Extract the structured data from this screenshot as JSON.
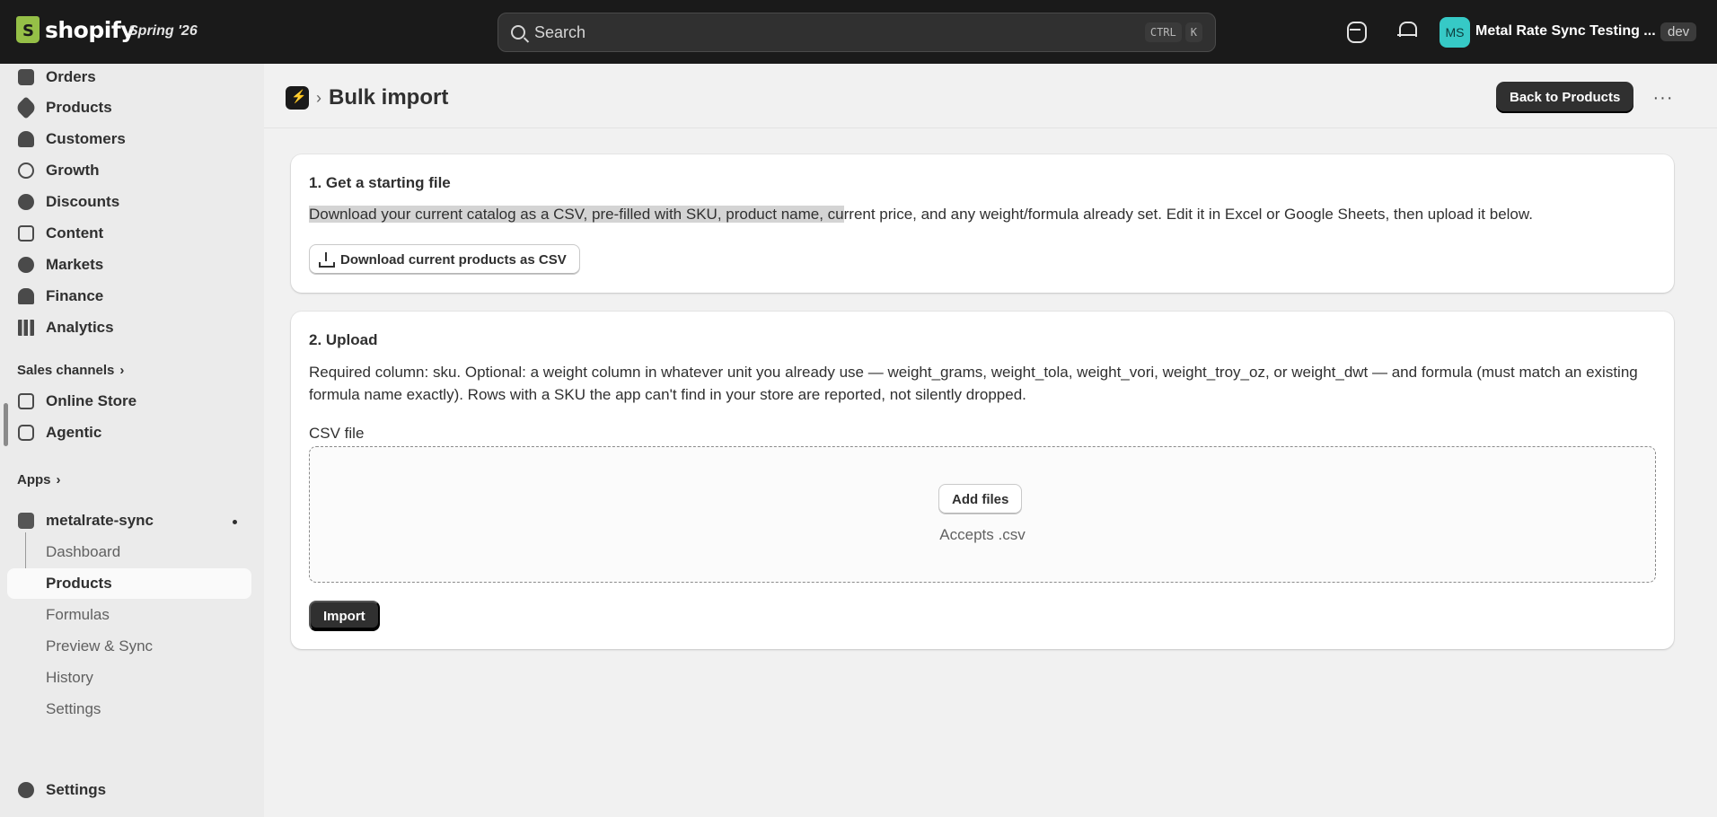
{
  "topbar": {
    "logo_text": "shopify",
    "edition": "Spring '26",
    "search_placeholder": "Search",
    "shortcut_keys": [
      "CTRL",
      "K"
    ],
    "avatar_initials": "MS",
    "store_name": "Metal Rate Sync Testing ...",
    "env_badge": "dev"
  },
  "sidebar": {
    "items": [
      {
        "label": "Orders",
        "icon": "inbox-icon"
      },
      {
        "label": "Products",
        "icon": "tag-icon"
      },
      {
        "label": "Customers",
        "icon": "person-icon"
      },
      {
        "label": "Growth",
        "icon": "gauge-icon"
      },
      {
        "label": "Discounts",
        "icon": "discount-icon"
      },
      {
        "label": "Content",
        "icon": "content-icon"
      },
      {
        "label": "Markets",
        "icon": "globe-icon"
      },
      {
        "label": "Finance",
        "icon": "bank-icon"
      },
      {
        "label": "Analytics",
        "icon": "bar-chart-icon"
      }
    ],
    "sales_channels_heading": "Sales channels",
    "channels": [
      {
        "label": "Online Store",
        "icon": "store-icon"
      },
      {
        "label": "Agentic",
        "icon": "robot-icon"
      }
    ],
    "apps_heading": "Apps",
    "app_name": "metalrate-sync",
    "app_subitems": [
      "Dashboard",
      "Products",
      "Formulas",
      "Preview & Sync",
      "History",
      "Settings"
    ],
    "active_subitem": "Products",
    "settings_label": "Settings"
  },
  "page": {
    "title": "Bulk import",
    "back_button": "Back to Products",
    "more_label": "···"
  },
  "card1": {
    "title": "1. Get a starting file",
    "text_highlighted": "Download your current catalog as a CSV, pre-filled with SKU, product name, cu",
    "text_rest": "rrent price, and any weight/formula already set. Edit it in Excel or Google Sheets, then upload it below.",
    "button": "Download current products as CSV"
  },
  "card2": {
    "title": "2. Upload",
    "text": "Required column: sku. Optional: a weight column in whatever unit you already use — weight_grams, weight_tola, weight_vori, weight_troy_oz, or weight_dwt — and formula (must match an existing formula name exactly). Rows with a SKU the app can't find in your store are reported, not silently dropped.",
    "field_label": "CSV file",
    "add_files_button": "Add files",
    "accepts_text": "Accepts .csv",
    "import_button": "Import"
  }
}
